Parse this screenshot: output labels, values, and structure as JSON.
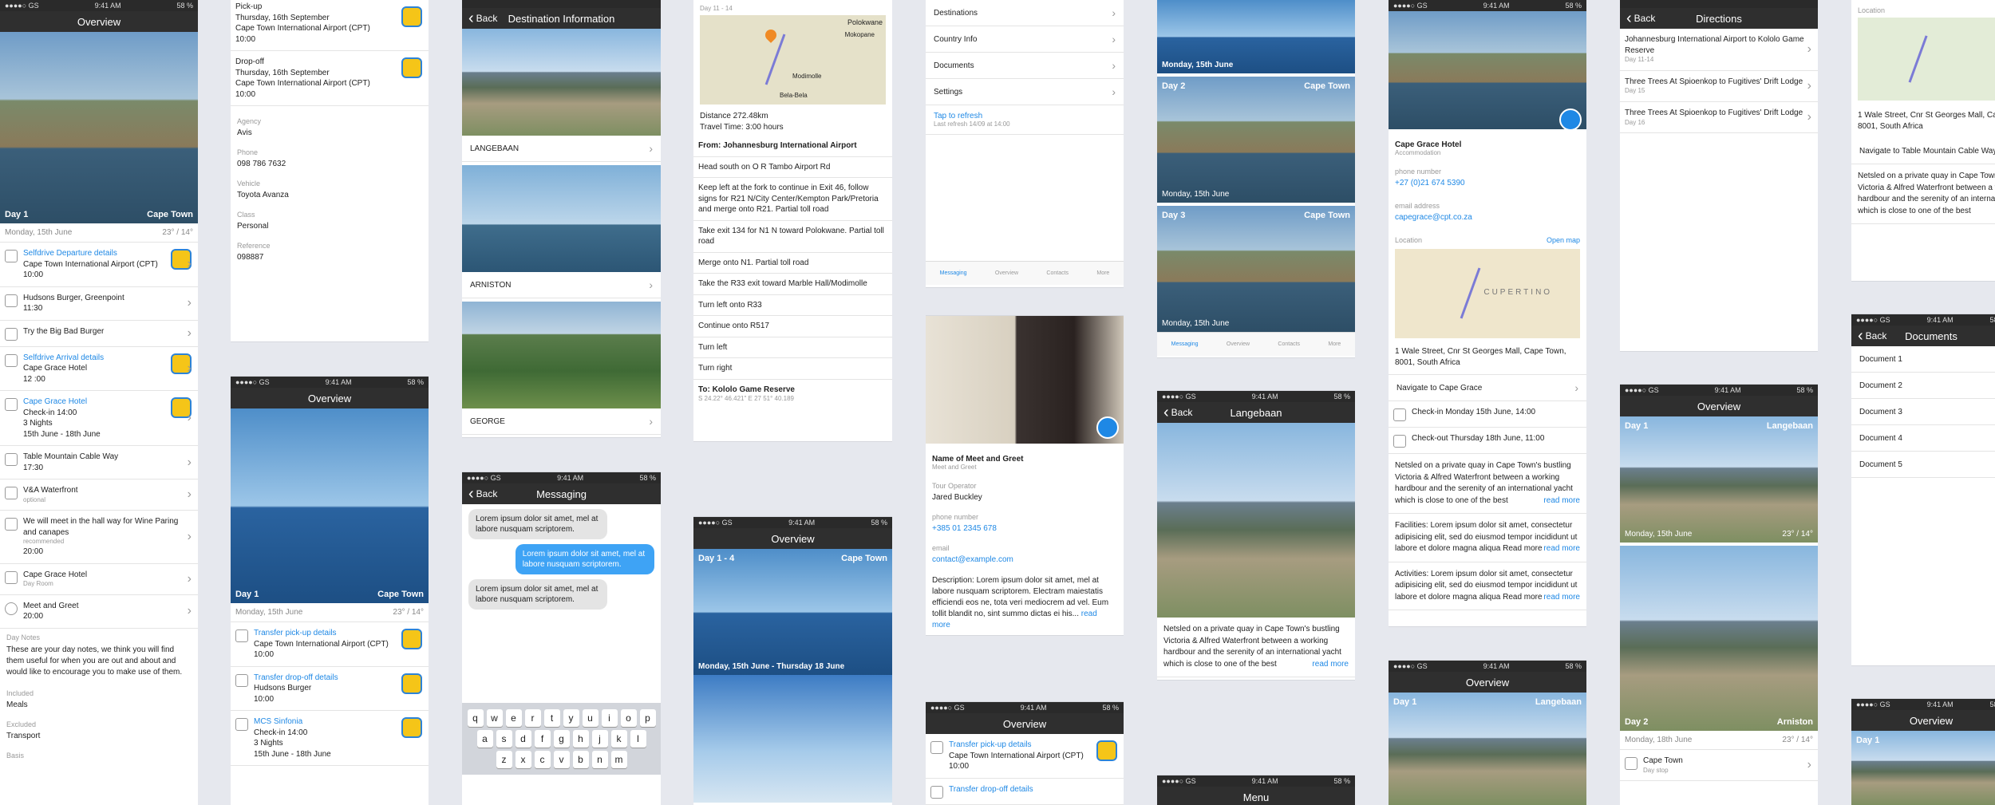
{
  "status": {
    "carrier": "●●●●○ GS",
    "time": "9:41 AM",
    "battery": "58 %"
  },
  "c1": {
    "title": "Overview",
    "hero_left": "Day 1",
    "hero_right": "Cape Town",
    "date": "Monday, 15th June",
    "temp": "23° / 14°",
    "rows": [
      {
        "t": "Selfdrive Departure details",
        "b": "Cape Town International Airport (CPT)",
        "c": "10:00"
      },
      {
        "t": "Hudsons Burger, Greenpoint",
        "b": "11:30"
      },
      {
        "t": "Try the Big Bad Burger"
      },
      {
        "t": "Selfdrive Arrival details",
        "b": "Cape Grace Hotel",
        "c": "12 :00"
      },
      {
        "t": "Cape Grace Hotel",
        "b": "Check-in 14:00",
        "c": "3 Nights",
        "d": "15th June - 18th June"
      },
      {
        "t": "Table Mountain Cable Way",
        "b": "17:30"
      },
      {
        "t": "V&A Waterfront",
        "b": "optional"
      },
      {
        "t": "We will meet in the hall way for Wine Paring and canapes",
        "b": "recommended",
        "c": "20:00"
      },
      {
        "t": "Cape Grace Hotel",
        "b": "Day Room"
      },
      {
        "t": "Meet and Greet",
        "b": "20:00"
      }
    ],
    "notes_label": "Day Notes",
    "notes": "These are your day notes, we think you will find them useful for when you are out and about and would like to encourage you to make use of them.",
    "inc_label": "Included",
    "inc": "Meals",
    "exc_label": "Excluded",
    "exc": "Transport",
    "basis": "Basis"
  },
  "c2": {
    "pickup": "Pick-up",
    "pickup_date": "Thursday, 16th September",
    "pickup_loc": "Cape Town International Airport (CPT)",
    "pickup_time": "10:00",
    "dropoff": "Drop-off",
    "dropoff_date": "Thursday, 16th September",
    "dropoff_loc": "Cape Town International Airport (CPT)",
    "dropoff_time": "10:00",
    "agency_l": "Agency",
    "agency": "Avis",
    "phone_l": "Phone",
    "phone": "098 786 7632",
    "vehicle_l": "Vehicle",
    "vehicle": "Toyota Avanza",
    "class_l": "Class",
    "class": "Personal",
    "ref_l": "Reference",
    "ref": "098887",
    "p2_title": "Overview",
    "p2_left": "Day 1",
    "p2_right": "Cape Town",
    "p2_date": "Monday, 15th June",
    "p2_temp": "23° / 14°",
    "p2_r1": "Transfer pick-up details",
    "p2_r1b": "Cape Town International Airport (CPT)",
    "p2_r1c": "10:00",
    "p2_r2": "Transfer drop-off details",
    "p2_r2b": "Hudsons Burger",
    "p2_r2c": "10:00",
    "p2_r3": "MCS Sinfonia",
    "p2_r3b": "Check-in 14:00",
    "p2_r3c": "3 Nights",
    "p2_r3d": "15th June - 18th June"
  },
  "c3": {
    "back": "Back",
    "title": "Destination Information",
    "d1": "LANGEBAAN",
    "d2": "ARNISTON",
    "d3": "GEORGE",
    "m_title": "Messaging",
    "m1": "Lorem ipsum dolor sit amet, mel at labore nusquam scriptorem.",
    "m2": "Lorem ipsum dolor sit amet, mel at labore nusquam scriptorem.",
    "m3": "Lorem ipsum dolor sit amet, mel at labore nusquam scriptorem.",
    "k1": [
      "q",
      "w",
      "e",
      "r",
      "t",
      "y",
      "u",
      "i",
      "o",
      "p"
    ],
    "k2": [
      "a",
      "s",
      "d",
      "f",
      "g",
      "h",
      "j",
      "k",
      "l"
    ],
    "k3": [
      "z",
      "x",
      "c",
      "v",
      "b",
      "n",
      "m"
    ]
  },
  "c4": {
    "range": "Day 11 - 14",
    "map1": "Polokwane",
    "map2": "Mokopane",
    "map3": "Modimolle",
    "map4": "Bela-Bela",
    "distance": "Distance 272.48km",
    "time": "Travel Time: 3:00 hours",
    "from": "From: Johannesburg International Airport",
    "steps": [
      "Head south on O R Tambo Airport Rd",
      "Keep left at the fork to continue in Exit 46, follow signs for R21 N/City Center/Kempton Park/Pretoria and merge onto R21. Partial toll road",
      "Take exit 134 for N1 N toward Polokwane. Partial toll road",
      "Merge onto N1. Partial toll road",
      "Take the R33 exit toward Marble Hall/Modimolle",
      "Turn left onto R33",
      "Continue onto R517",
      "Turn left",
      "Turn right"
    ],
    "to": "To: Kololo Game Reserve",
    "coords": "S 24.22° 46.421\" E 27 51° 40.189",
    "p2_title": "Overview",
    "p2_left": "Day 1 - 4",
    "p2_right": "Cape Town",
    "p2_date": "Monday, 15th June - Thursday 18 June"
  },
  "c5": {
    "menu": [
      "Destinations",
      "Country Info",
      "Documents",
      "Settings"
    ],
    "refresh": "Tap to refresh",
    "refresh_sub": "Last refresh 14/09 at 14:00",
    "tabs": [
      "Messaging",
      "Overview",
      "Contacts",
      "More"
    ],
    "name": "Name of Meet and Greet",
    "role": "Meet and Greet",
    "op_l": "Tour Operator",
    "op": "Jared Buckley",
    "ph_l": "phone number",
    "ph": "+385 01 2345 678",
    "em_l": "email",
    "em": "contact@example.com",
    "desc": "Description: Lorem ipsum dolor sit amet, mel at labore nusquam scriptorem. Electram maiestatis efficiendi eos ne, tota veri mediocrem ad vel. Eum tollit blandit no, sint summo dictas ei his...",
    "more": "read more",
    "p3_title": "Overview",
    "p3_r1": "Transfer pick-up details",
    "p3_r1b": "Cape Town International Airport (CPT)",
    "p3_r1c": "10:00",
    "p3_r2": "Transfer drop-off details"
  },
  "c6": {
    "d0_date": "Monday, 15th June",
    "d2_left": "Day 2",
    "d2_right": "Cape Town",
    "d2_date": "Monday, 15th June",
    "d3_left": "Day 3",
    "d3_right": "Cape Town",
    "d3_date": "Monday, 15th June",
    "tabs": [
      "Messaging",
      "Overview",
      "Contacts",
      "More"
    ],
    "back": "Back",
    "title": "Langebaan",
    "text": "Netsled on a private quay in Cape Town's bustling Victoria & Alfred Waterfront between a working hardbour and the serenity of an international yacht which is close to one of the best",
    "more": "read more",
    "menu_title": "Menu"
  },
  "c7": {
    "hotel": "Cape Grace Hotel",
    "type": "Accommodation",
    "ph_l": "phone number",
    "ph": "+27 (0)21 674 5390",
    "em_l": "email address",
    "em": "capegrace@cpt.co.za",
    "loc_l": "Location",
    "open": "Open map",
    "map_label": "CUPERTINO",
    "addr": "1 Wale Street, Cnr St Georges Mall, Cape Town, 8001, South Africa",
    "nav": "Navigate to Cape Grace",
    "checkin": "Check-in Monday 15th June, 14:00",
    "checkout": "Check-out Thursday 18th June, 11:00",
    "p1": "Netsled on a private quay in Cape Town's bustling Victoria & Alfred Waterfront between a working hardbour and the serenity of an international yacht which is close to one of the best",
    "p2": "Facilities: Lorem ipsum dolor sit amet, consectetur adipisicing elit, sed do eiusmod tempor incididunt ut labore et dolore magna aliqua Read more",
    "p3": "Activities: Lorem ipsum dolor sit amet, consectetur adipisicing elit, sed do eiusmod tempor incididunt ut labore et dolore magna aliqua Read more",
    "more": "read more",
    "p2_title": "Overview",
    "p2_left": "Day 1",
    "p2_right": "Langebaan"
  },
  "c8": {
    "back": "Back",
    "title": "Directions",
    "dirs": [
      {
        "t": "Johannesburg International Airport to Kololo Game Reserve",
        "d": "Day 11-14"
      },
      {
        "t": "Three Trees At Spioenkop to Fugitives' Drift Lodge",
        "d": "Day 15"
      },
      {
        "t": "Three Trees At Spioenkop to Fugitives' Drift Lodge",
        "d": "Day 16"
      }
    ],
    "p2_title": "Overview",
    "h1_left": "Day 1",
    "h1_right": "Langebaan",
    "h1_date": "Monday, 15th June",
    "h1_temp": "23° / 14°",
    "h2_left": "Day 2",
    "h2_right": "Arniston",
    "date2": "Monday, 18th June",
    "temp2": "23° / 14°",
    "row": "Cape Town",
    "row_sub": "Day stop"
  },
  "c9": {
    "loc_l": "Location",
    "addr": "1 Wale Street, Cnr St Georges Mall, Ca 8001, South Africa",
    "nav": "Navigate to Table Mountain Cable Way",
    "text": "Netsled on a private quay in Cape Town Victoria & Alfred Waterfront between a w hardbour and the serenity of an internat which is close to one of the best",
    "back": "Back",
    "docs_title": "Documents",
    "docs": [
      "Document 1",
      "Document 2",
      "Document 3",
      "Document 4",
      "Document 5"
    ],
    "p3_title": "Overview",
    "p3_left": "Day 1"
  }
}
